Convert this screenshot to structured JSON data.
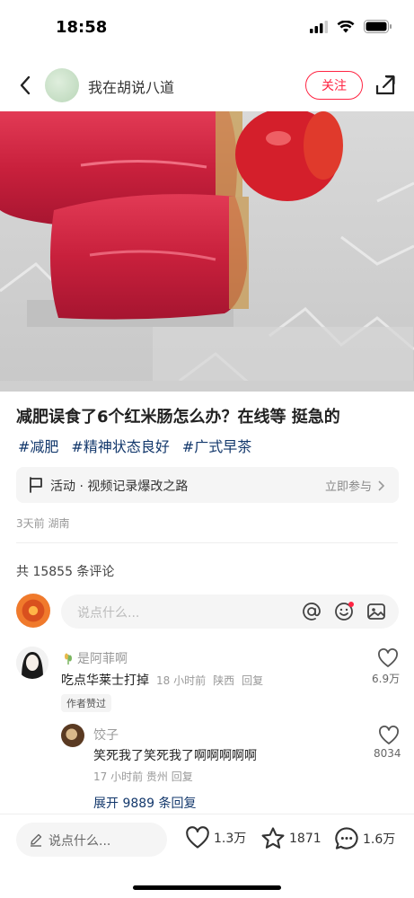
{
  "status_bar": {
    "time": "18:58"
  },
  "header": {
    "author": "我在胡说八道",
    "follow_label": "关注"
  },
  "post": {
    "title": "减肥误食了6个红米肠怎么办？在线等 挺急的",
    "tags": [
      "#减肥",
      "#精神状态良好",
      "#广式早茶"
    ],
    "activity": {
      "label": "活动 · 视频记录爆改之路",
      "cta": "立即参与"
    },
    "meta": "3天前 湖南"
  },
  "comments": {
    "count_text": "共 15855 条评论",
    "input_placeholder": "说点什么...",
    "items": [
      {
        "user": "是阿菲啊",
        "text": "吃点华莱士打掉",
        "time": "18 小时前",
        "location": "陕西",
        "reply_label": "回复",
        "badge": "作者赞过",
        "likes": "6.9万",
        "replies": [
          {
            "user": "饺子",
            "text": "笑死我了笑死我了啊啊啊啊啊",
            "meta": "17 小时前 贵州 回复",
            "likes": "8034"
          }
        ],
        "expand_label": "展开 9889 条回复"
      }
    ]
  },
  "bottom_bar": {
    "input_placeholder": "说点什么...",
    "like_count": "1.3万",
    "fav_count": "1871",
    "comment_count": "1.6万"
  },
  "colors": {
    "accent": "#ff2442",
    "tag": "#13386c"
  }
}
